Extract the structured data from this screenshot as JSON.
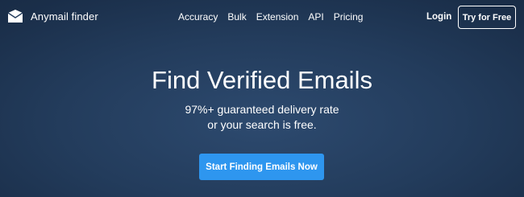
{
  "brand": {
    "name": "Anymail finder",
    "logo_icon": "envelope-icon"
  },
  "nav": {
    "links": [
      "Accuracy",
      "Bulk",
      "Extension",
      "API",
      "Pricing"
    ],
    "login_label": "Login",
    "try_label": "Try for Free"
  },
  "hero": {
    "title": "Find Verified Emails",
    "subtitle_line1": "97%+ guaranteed delivery rate",
    "subtitle_line2": "or your search is free.",
    "cta_label": "Start Finding Emails Now"
  },
  "colors": {
    "background": "#233c5c",
    "cta": "#2e96ef",
    "text": "#ffffff"
  }
}
